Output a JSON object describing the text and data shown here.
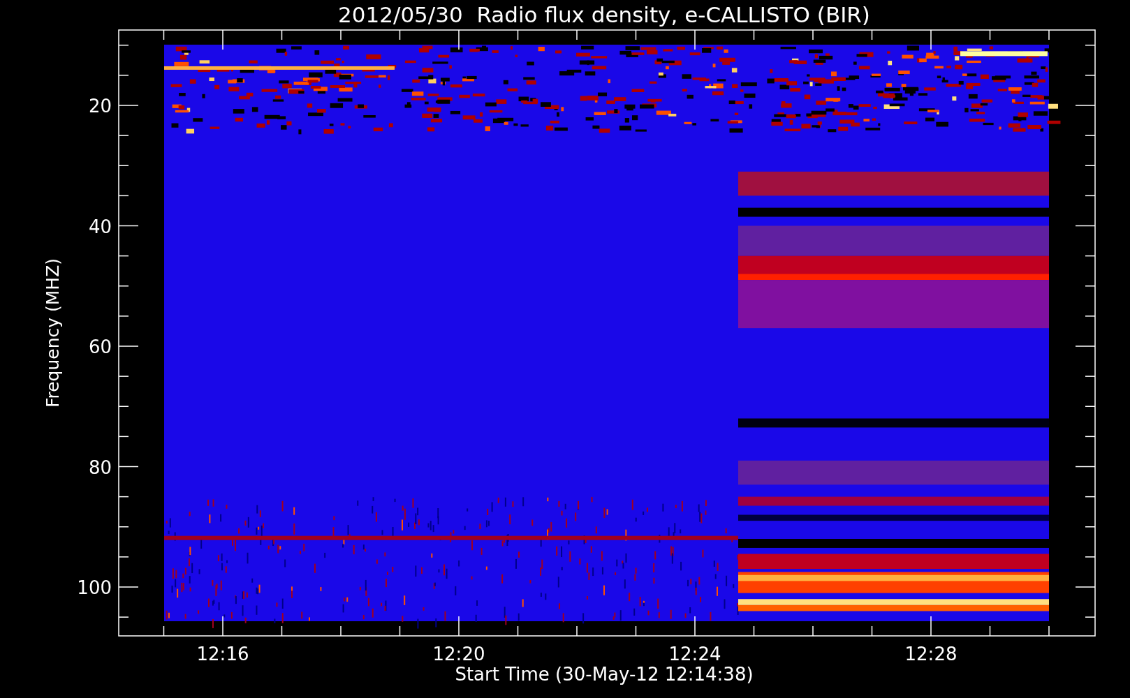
{
  "title": "2012/05/30  Radio flux density, e-CALLISTO (BIR)",
  "y_axis": {
    "label": "Frequency (MHZ)",
    "ticks": [
      "20",
      "40",
      "60",
      "80",
      "100"
    ]
  },
  "x_axis": {
    "label": "Start Time (30-May-12 12:14:38)",
    "ticks": [
      "12:16",
      "12:20",
      "12:24",
      "12:28"
    ]
  }
}
